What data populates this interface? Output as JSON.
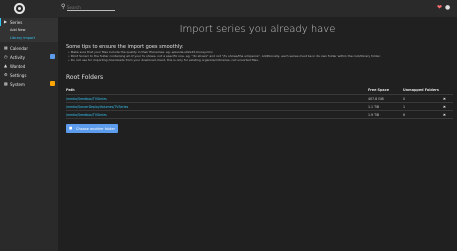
{
  "header": {
    "search_placeholder": "Search",
    "icons": [
      "logo",
      "search-icon",
      "heart-icon",
      "user-icon"
    ],
    "heart_color": "#ff6f6f"
  },
  "sidebar": {
    "items": [
      {
        "label": "Series",
        "icon": "play-icon"
      },
      {
        "label": "Add New"
      },
      {
        "label": "Library Import"
      },
      {
        "label": "Calendar",
        "icon": "calendar-icon"
      },
      {
        "label": "Activity",
        "icon": "clock-icon",
        "badge_color": "#5d9cec"
      },
      {
        "label": "Wanted",
        "icon": "warning-icon"
      },
      {
        "label": "Settings",
        "icon": "gear-icon"
      },
      {
        "label": "System",
        "icon": "laptop-icon",
        "badge_color": "#ffa500"
      }
    ],
    "accent_color": "#35c5f4"
  },
  "main": {
    "title": "Import series you already have",
    "tips_heading": "Some tips to ensure the import goes smoothly:",
    "tips": [
      "Make sure that your files include the quality in their filenames. eg. episode.s02e15.bluray.mkv",
      "Point Sonarr to the folder containing all of your tv shows, not a specific one. eg. \"/tv shows\" and not \"/tv shows/the simpsons\". Additionally, each series must be in its own folder within the root/library folder.",
      "Do not use for importing downloads from your download client, this is only for existing organized libraries, not unsorted files."
    ],
    "root_folders_heading": "Root Folders",
    "table": {
      "headers": [
        "Path",
        "Free Space",
        "Unmapped Folders"
      ],
      "rows": [
        {
          "path": "/media/Seedbox/TVSeries",
          "free_space": "407.8 GiB",
          "unmapped": "0"
        },
        {
          "path": "/media/SonarrDeployVolumes/TVSeries",
          "free_space": "1.1 TiB",
          "unmapped": "1"
        },
        {
          "path": "/media/Seedbox/TVSeries",
          "free_space": "1.9 TiB",
          "unmapped": "6"
        }
      ]
    },
    "choose_button_label": "Choose another folder"
  }
}
